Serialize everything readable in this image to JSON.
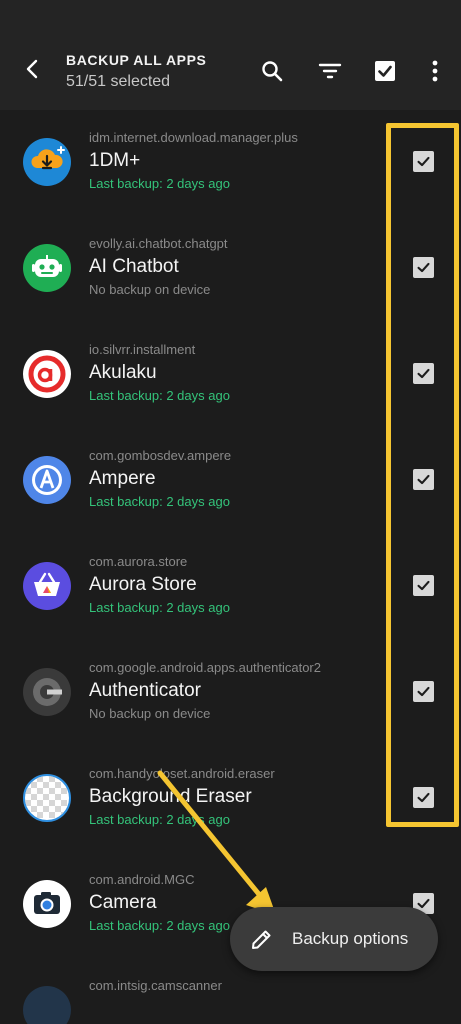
{
  "header": {
    "title": "BACKUP ALL APPS",
    "subtitle": "51/51 selected"
  },
  "apps": [
    {
      "package": "idm.internet.download.manager.plus",
      "name": "1DM+",
      "status": "Last backup: 2 days ago",
      "status_type": "ok",
      "icon": "download-cloud-icon",
      "checked": true
    },
    {
      "package": "evolly.ai.chatbot.chatgpt",
      "name": "AI Chatbot",
      "status": "No backup on device",
      "status_type": "none",
      "icon": "robot-icon",
      "checked": true
    },
    {
      "package": "io.silvrr.installment",
      "name": "Akulaku",
      "status": "Last backup: 2 days ago",
      "status_type": "ok",
      "icon": "akulaku-logo-icon",
      "checked": true
    },
    {
      "package": "com.gombosdev.ampere",
      "name": "Ampere",
      "status": "Last backup: 2 days ago",
      "status_type": "ok",
      "icon": "ampere-logo-icon",
      "checked": true
    },
    {
      "package": "com.aurora.store",
      "name": "Aurora Store",
      "status": "Last backup: 2 days ago",
      "status_type": "ok",
      "icon": "shopping-basket-icon",
      "checked": true
    },
    {
      "package": "com.google.android.apps.authenticator2",
      "name": "Authenticator",
      "status": "No backup on device",
      "status_type": "none",
      "icon": "authenticator-icon",
      "checked": true
    },
    {
      "package": "com.handyoloset.android.eraser",
      "name": "Background Eraser",
      "status": "Last backup: 2 days ago",
      "status_type": "ok",
      "icon": "transparent-grid-icon",
      "checked": true
    },
    {
      "package": "com.android.MGC",
      "name": "Camera",
      "status": "Last backup: 2 days ago",
      "status_type": "ok",
      "icon": "camera-icon",
      "checked": true
    },
    {
      "package": "com.intsig.camscanner",
      "name": "",
      "status": "",
      "status_type": "none",
      "icon": "camscanner-icon",
      "checked": true
    }
  ],
  "fab": {
    "label": "Backup options",
    "icon": "pencil-icon"
  },
  "colors": {
    "background": "#1c1c1c",
    "appbar": "#242424",
    "accent_green": "#34c37a",
    "highlight_yellow": "#f5c531"
  }
}
